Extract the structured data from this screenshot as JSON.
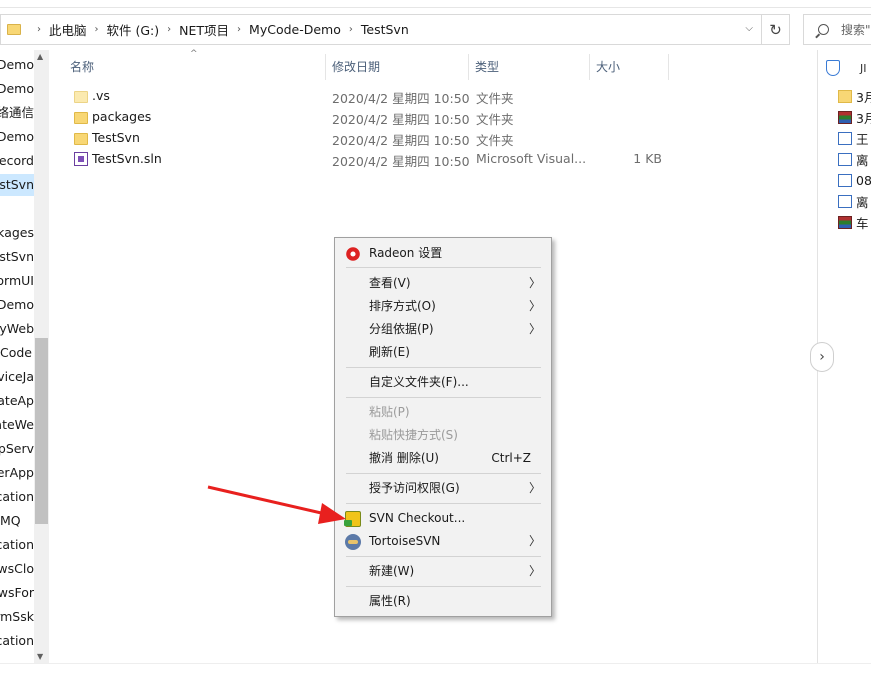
{
  "address_bar": {
    "crumbs": [
      "此电脑",
      "软件 (G:)",
      "NET项目",
      "MyCode-Demo",
      "TestSvn"
    ],
    "search_placeholder": "搜索\""
  },
  "nav_pane": {
    "items": [
      {
        "label": "MyCode-Demo",
        "selected": false
      },
      {
        "label": "InterfacDemo",
        "selected": false
      },
      {
        "label": "网络通信",
        "selected": false
      },
      {
        "label": "MyCode-Demo",
        "selected": false
      },
      {
        "label": "FirstRecord",
        "selected": false
      },
      {
        "label": "TestSvn",
        "selected": true
      },
      {
        "label": "",
        "selected": false
      },
      {
        "label": "packages",
        "selected": false
      },
      {
        "label": "TestSvn",
        "selected": false
      },
      {
        "label": "WinFormUI",
        "selected": false
      },
      {
        "label": "EnumDemo",
        "selected": false
      },
      {
        "label": "MyWeb",
        "selected": false
      },
      {
        "label": "Code",
        "selected": false
      },
      {
        "label": "WebServiceJa",
        "selected": false
      },
      {
        "label": "CreateAp",
        "selected": false
      },
      {
        "label": "CreateWe",
        "selected": false
      },
      {
        "label": "HttpServ",
        "selected": false
      },
      {
        "label": "ServerApp",
        "selected": false
      },
      {
        "label": "Application",
        "selected": false
      },
      {
        "label": "MQ",
        "selected": false
      },
      {
        "label": "Application",
        "selected": false
      },
      {
        "label": "WindowsClo",
        "selected": false
      },
      {
        "label": "WindowsFor",
        "selected": false
      },
      {
        "label": "FormSsk",
        "selected": false
      },
      {
        "label": "Application",
        "selected": false
      }
    ]
  },
  "columns": {
    "name": "名称",
    "date": "修改日期",
    "type": "类型",
    "size": "大小"
  },
  "files": [
    {
      "name": ".vs",
      "date": "2020/4/2 星期四 10:50",
      "type": "文件夹",
      "size": "",
      "icon": "folder-hidden-icon"
    },
    {
      "name": "packages",
      "date": "2020/4/2 星期四 10:50",
      "type": "文件夹",
      "size": "",
      "icon": "folder-icon"
    },
    {
      "name": "TestSvn",
      "date": "2020/4/2 星期四 10:50",
      "type": "文件夹",
      "size": "",
      "icon": "folder-icon"
    },
    {
      "name": "TestSvn.sln",
      "date": "2020/4/2 星期四 10:50",
      "type": "Microsoft Visual...",
      "size": "1 KB",
      "icon": "visual-studio-solution-icon"
    }
  ],
  "preview_pane": {
    "title": "JI",
    "items": [
      {
        "label": "3月",
        "icon": "folder-icon"
      },
      {
        "label": "3月",
        "icon": "rar-archive-icon"
      },
      {
        "label": "王",
        "icon": "word-doc-icon"
      },
      {
        "label": "离",
        "icon": "word-doc-icon"
      },
      {
        "label": "08",
        "icon": "word-doc-icon"
      },
      {
        "label": "离",
        "icon": "word-doc-icon"
      },
      {
        "label": "车",
        "icon": "rar-archive-icon"
      }
    ]
  },
  "context_menu": {
    "items": {
      "radeon": "Radeon 设置",
      "view": "查看(V)",
      "sort": "排序方式(O)",
      "group": "分组依据(P)",
      "refresh": "刷新(E)",
      "customize": "自定义文件夹(F)...",
      "paste": "粘贴(P)",
      "paste_shortcut": "粘贴快捷方式(S)",
      "undo": "撤消 删除(U)",
      "undo_shortcut": "Ctrl+Z",
      "grant_access": "授予访问权限(G)",
      "svn_checkout": "SVN Checkout...",
      "tortoise": "TortoiseSVN",
      "new": "新建(W)",
      "properties": "属性(R)"
    }
  },
  "colors": {
    "selection": "#cce8ff",
    "annotation_arrow": "#e8201e",
    "menu_bg": "#f2f2f2"
  }
}
